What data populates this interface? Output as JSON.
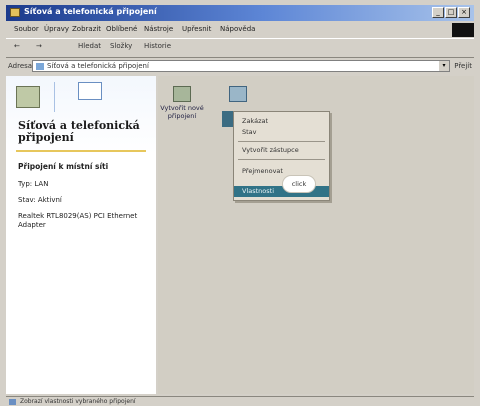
{
  "window": {
    "title": "Síťová a telefonická připojení"
  },
  "menu": [
    "Soubor",
    "Úpravy",
    "Zobrazit",
    "Oblíbené",
    "Nástroje",
    "Upřesnit",
    "Nápověda"
  ],
  "toolbar": {
    "back": "←",
    "forward": "→",
    "search": "Hledat",
    "folders": "Složky",
    "history": "Historie"
  },
  "address": {
    "label": "Adresa",
    "value": "Síťová a telefonická připojení",
    "go": "Přejít"
  },
  "sidebar": {
    "title_line1": "Síťová a telefonická",
    "title_line2": "připojení",
    "heading": "Připojení k místní síti",
    "type": "Typ: LAN",
    "status": "Stav: Aktivní",
    "adapter": "Realtek RTL8029(AS) PCI Ethernet Adapter"
  },
  "icons": {
    "new_connection": {
      "line1": "Vytvořit nové",
      "line2": "připojení"
    }
  },
  "context_menu": {
    "items": [
      "Zakázat",
      "Stav",
      "Vytvořit zástupce",
      "Přejmenovat",
      "Vlastnosti"
    ],
    "highlighted_index": 4
  },
  "callout": {
    "text": "click"
  },
  "statusbar": {
    "text": "Zobrazí vlastnosti vybraného připojení"
  },
  "colors": {
    "titlebar": "#1b3a8c",
    "highlight": "#317387",
    "pane": "#d2cec4"
  }
}
